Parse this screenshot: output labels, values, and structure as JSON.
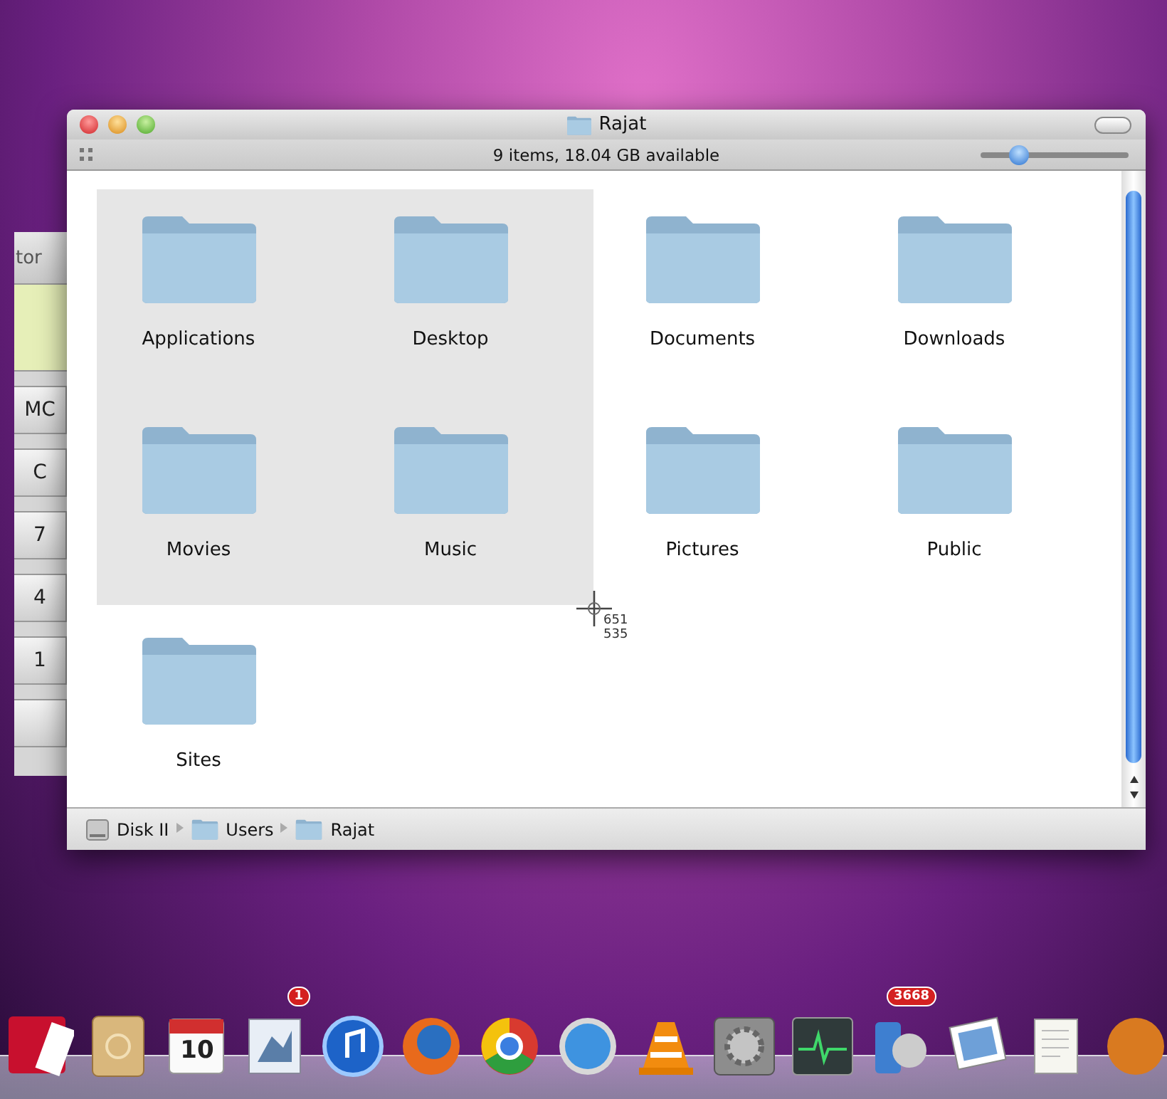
{
  "calculator": {
    "title": "tor",
    "buttons": [
      "MC",
      "C",
      "7",
      "4",
      "1"
    ]
  },
  "window": {
    "title": "Rajat",
    "status": "9 items, 18.04 GB available",
    "icon_size_slider": {
      "level": 0.26
    },
    "items": [
      {
        "name": "Applications"
      },
      {
        "name": "Desktop"
      },
      {
        "name": "Documents"
      },
      {
        "name": "Downloads"
      },
      {
        "name": "Movies"
      },
      {
        "name": "Music"
      },
      {
        "name": "Pictures"
      },
      {
        "name": "Public"
      },
      {
        "name": "Sites"
      }
    ],
    "path": [
      {
        "kind": "disk",
        "label": "Disk II"
      },
      {
        "kind": "folder",
        "label": "Users"
      },
      {
        "kind": "folder",
        "label": "Rajat"
      }
    ]
  },
  "cursor": {
    "x_reading": "651",
    "y_reading": "535"
  },
  "dock": [
    {
      "kind": "photobooth"
    },
    {
      "kind": "addressbook"
    },
    {
      "kind": "calendar",
      "date": "10"
    },
    {
      "kind": "mail",
      "badge": "1"
    },
    {
      "kind": "itunes"
    },
    {
      "kind": "firefox"
    },
    {
      "kind": "chrome"
    },
    {
      "kind": "safari"
    },
    {
      "kind": "vlc"
    },
    {
      "kind": "preferences"
    },
    {
      "kind": "activity"
    },
    {
      "kind": "iphone",
      "badge": "3668"
    },
    {
      "kind": "photos"
    },
    {
      "kind": "textedit"
    },
    {
      "kind": "partial"
    }
  ]
}
